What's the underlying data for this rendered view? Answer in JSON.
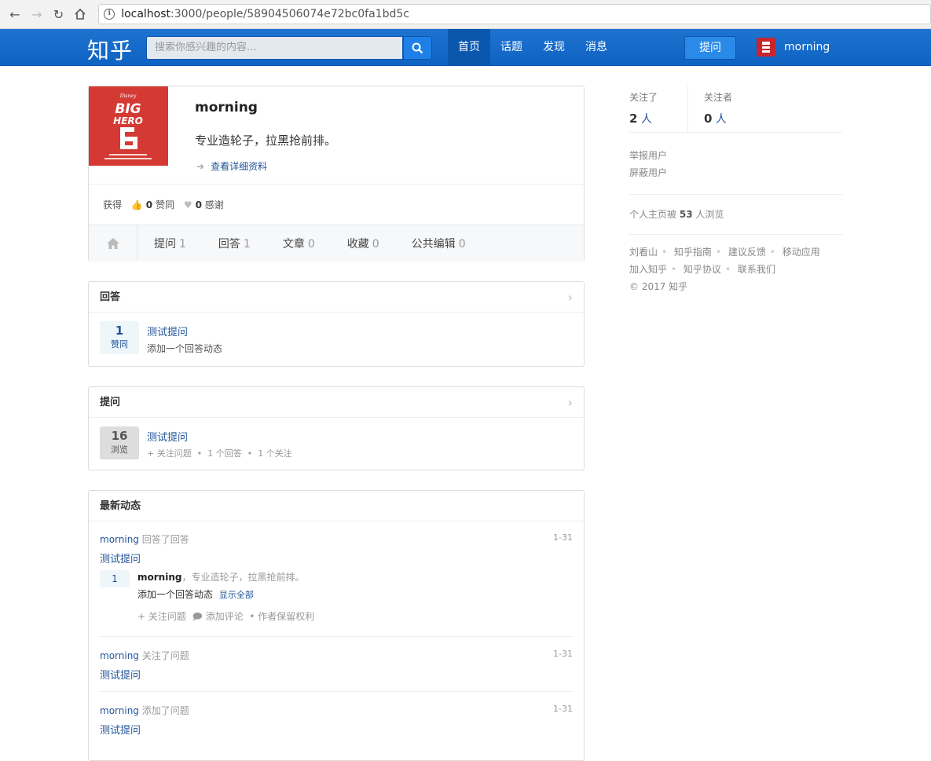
{
  "browser": {
    "url_host": "localhost",
    "url_path": ":3000/people/58904506074e72bc0fa1bd5c"
  },
  "topbar": {
    "logo": "知乎",
    "search_placeholder": "搜索你感兴趣的内容...",
    "nav": [
      "首页",
      "话题",
      "发现",
      "消息"
    ],
    "ask_label": "提问",
    "username": "morning"
  },
  "profile": {
    "name": "morning",
    "bio": "专业造轮子，拉黑抢前排。",
    "detail_link": "查看详细资料",
    "stats_prefix": "获得",
    "agree_count": "0",
    "agree_label": "赞同",
    "thanks_count": "0",
    "thanks_label": "感谢",
    "tabs": [
      {
        "label": "提问",
        "count": "1"
      },
      {
        "label": "回答",
        "count": "1"
      },
      {
        "label": "文章",
        "count": "0"
      },
      {
        "label": "收藏",
        "count": "0"
      },
      {
        "label": "公共编辑",
        "count": "0"
      }
    ]
  },
  "answers": {
    "title": "回答",
    "votes": "1",
    "votes_label": "赞同",
    "question": "测试提问",
    "excerpt": "添加一个回答动态"
  },
  "questions": {
    "title": "提问",
    "views": "16",
    "views_label": "浏览",
    "question": "测试提问",
    "follow_action": "关注问题",
    "answer_count": "1 个回答",
    "follower_count": "1 个关注"
  },
  "feed": {
    "title": "最新动态",
    "items": [
      {
        "who": "morning",
        "action": "回答了回答",
        "time": "1-31",
        "question": "测试提问"
      },
      {
        "who": "morning",
        "action": "关注了问题",
        "time": "1-31",
        "question": "测试提问"
      },
      {
        "who": "morning",
        "action": "添加了问题",
        "time": "1-31",
        "question": "测试提问"
      }
    ],
    "answer": {
      "votes": "1",
      "author": "morning",
      "author_bio": "专业造轮子，拉黑抢前排。",
      "content": "添加一个回答动态",
      "show_all": "显示全部",
      "follow": "关注问题",
      "comment": "添加评论",
      "copyright": "作者保留权利"
    }
  },
  "sidebar": {
    "following_label": "关注了",
    "following_count": "2",
    "followers_label": "关注者",
    "followers_count": "0",
    "person_unit": "人",
    "report_user": "举报用户",
    "block_user": "屏蔽用户",
    "views_prefix": "个人主页被",
    "views_count": "53",
    "views_suffix": "人浏览",
    "footer_row1": [
      "刘看山",
      "知乎指南",
      "建议反馈",
      "移动应用"
    ],
    "footer_row2": [
      "加入知乎",
      "知乎协议",
      "联系我们"
    ],
    "copyright": "© 2017 知乎"
  },
  "colors": {
    "brand_blue": "#0f66c9",
    "link_blue": "#225599",
    "avatar_red": "#d43a33"
  }
}
